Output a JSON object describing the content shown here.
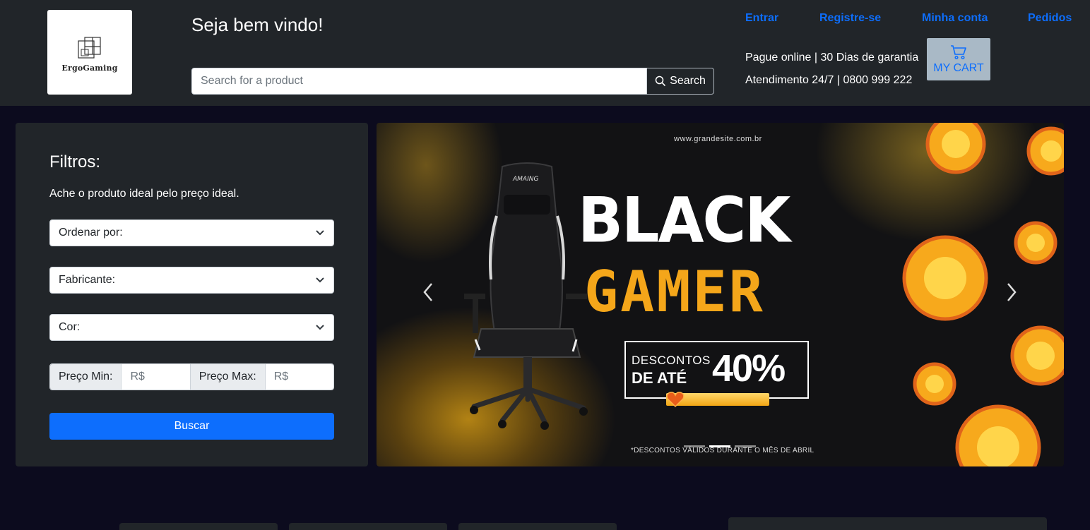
{
  "header": {
    "logo_text": "ErgoGaming",
    "welcome": "Seja bem vindo!",
    "search": {
      "placeholder": "Search for a product",
      "button_label": "Search"
    },
    "nav": [
      "Entrar",
      "Registre-se",
      "Minha conta",
      "Pedidos"
    ],
    "info_line1": "Pague online | 30 Dias de garantia",
    "info_line2": "Atendimento 24/7 | 0800 999 222",
    "cart_label": "MY CART",
    "colors": {
      "link": "#0d6efd",
      "cart_bg": "#a9b9c6",
      "header_bg": "#212529"
    }
  },
  "filters": {
    "title": "Filtros:",
    "subtitle": "Ache o produto ideal pelo preço ideal.",
    "order_by": "Ordenar por:",
    "manufacturer": "Fabricante:",
    "color": "Cor:",
    "price_min_label": "Preço Min:",
    "price_min_placeholder": "R$",
    "price_max_label": "Preço Max:",
    "price_max_placeholder": "R$",
    "submit_label": "Buscar"
  },
  "carousel": {
    "site": "www.grandesite.com.br",
    "headline1": "BLACK",
    "headline2": "GAMER",
    "discount_line1": "DESCONTOS",
    "discount_line2": "DE ATÉ",
    "discount_value": "40%",
    "footnote": "*DESCONTOS VÁLIDOS DURANTE O MÊS DE ABRIL",
    "chair_brand": "AMAING",
    "slide_count": 3,
    "active_slide": 2,
    "colors": {
      "accent": "#f4a61a"
    }
  }
}
